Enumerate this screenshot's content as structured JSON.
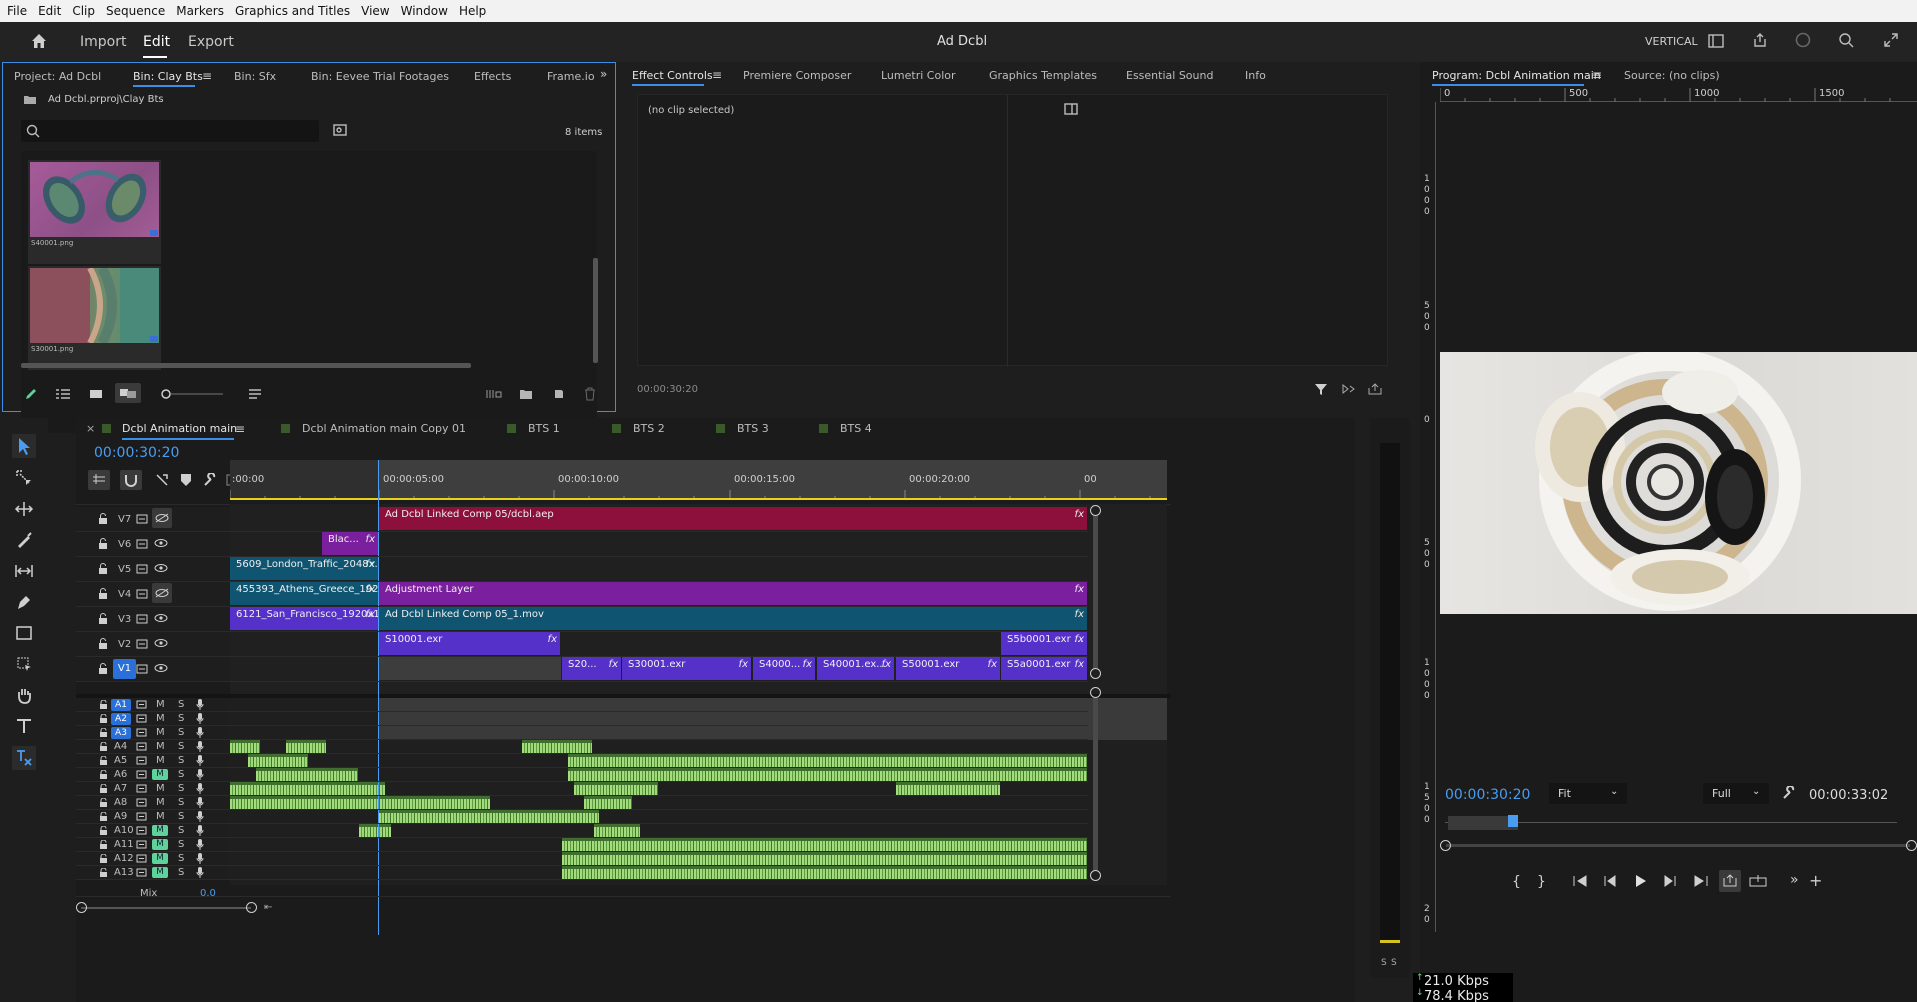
{
  "menu": [
    "File",
    "Edit",
    "Clip",
    "Sequence",
    "Markers",
    "Graphics and Titles",
    "View",
    "Window",
    "Help"
  ],
  "header": {
    "workspaces": [
      "Import",
      "Edit",
      "Export"
    ],
    "active_workspace": "Edit",
    "project_title": "Ad Dcbl",
    "layout_mode": "VERTICAL"
  },
  "project_panel": {
    "tabs": [
      "Project: Ad Dcbl",
      "Bin: Clay Bts",
      "Bin: Sfx",
      "Bin: Eevee Trial Footages",
      "Effects",
      "Frame.io"
    ],
    "active_tab": "Bin: Clay Bts",
    "path": "Ad Dcbl.prproj\\Clay Bts",
    "search_placeholder": "",
    "item_count": "8 items",
    "thumbnails": [
      {
        "name": "S40001.png"
      },
      {
        "name": "S30001.png"
      }
    ]
  },
  "effect_controls": {
    "tabs": [
      "Effect Controls",
      "Premiere Composer",
      "Lumetri Color",
      "Graphics Templates",
      "Essential Sound",
      "Info"
    ],
    "active_tab": "Effect Controls",
    "message": "(no clip selected)",
    "timecode": "00:00:30:20"
  },
  "program_monitor": {
    "tabs": [
      "Program: Dcbl Animation main",
      "Source: (no clips)"
    ],
    "active_tab": "Program: Dcbl Animation main",
    "ruler_h": [
      "0",
      "500",
      "1000",
      "1500"
    ],
    "ruler_v": [
      "1\n0\n0\n0",
      "5\n0\n0",
      "0",
      "5\n0\n0",
      "1\n0\n0\n0",
      "1\n5\n0\n0",
      "2\n0"
    ],
    "timecode": "00:00:30:20",
    "fit_label": "Fit",
    "quality_label": "Full",
    "duration": "00:00:33:02"
  },
  "timeline": {
    "tabs": [
      "Dcbl Animation main",
      "Dcbl Animation main  Copy 01",
      "BTS 1",
      "BTS 2",
      "BTS 3",
      "BTS 4"
    ],
    "active_tab": "Dcbl Animation main",
    "timecode": "00:00:30:20",
    "ruler": [
      ":00:00",
      "00:00:05:00",
      "00:00:10:00",
      "00:00:15:00",
      "00:00:20:00",
      "00"
    ],
    "video_tracks": [
      "V7",
      "V6",
      "V5",
      "V4",
      "V3",
      "V2",
      "V1"
    ],
    "audio_tracks": [
      "A1",
      "A2",
      "A3",
      "A4",
      "A5",
      "A6",
      "A7",
      "A8",
      "A9",
      "A10",
      "A11",
      "A12",
      "A13"
    ],
    "mix_label": "Mix",
    "mix_value": "0.0",
    "mute_label": "M",
    "solo_label": "S",
    "video_clips": [
      {
        "track": "V7",
        "label": "Ad Dcbl Linked Comp 05/dcbl.aep",
        "fx": "fx"
      },
      {
        "track": "V6",
        "label": "Blac...",
        "fx": "fx"
      },
      {
        "track": "V5",
        "label": "5609_London_Traffic_2048x...",
        "fx": "fx"
      },
      {
        "track": "V4",
        "label": "455393_Athens_Greece_192...",
        "fx": "fx"
      },
      {
        "track": "V4",
        "label": "Adjustment Layer",
        "fx": "fx"
      },
      {
        "track": "V3",
        "label": "6121_San_Francisco_1920x1...",
        "fx": "fx"
      },
      {
        "track": "V3",
        "label": "Ad Dcbl Linked Comp 05_1.mov",
        "fx": "fx"
      },
      {
        "track": "V2",
        "label": "S10001.exr",
        "fx": "fx"
      },
      {
        "track": "V2",
        "label": "S5b0001.exr ...",
        "fx": "fx"
      },
      {
        "track": "V1",
        "label": "S20...",
        "fx": "fx"
      },
      {
        "track": "V1",
        "label": "S30001.exr",
        "fx": "fx"
      },
      {
        "track": "V1",
        "label": "S4000...",
        "fx": "fx"
      },
      {
        "track": "V1",
        "label": "S40001.ex...",
        "fx": "fx"
      },
      {
        "track": "V1",
        "label": "S50001.exr",
        "fx": "fx"
      },
      {
        "track": "V1",
        "label": "S5a0001.exr",
        "fx": "fx"
      }
    ]
  },
  "audio_meter": {
    "labels": [
      "S",
      "S"
    ]
  },
  "network": {
    "up": "21.0 Kbps",
    "down": "78.4 Kbps"
  },
  "colors": {
    "accent": "#3a8ee6",
    "clip_crimson": "#8c0f3c",
    "clip_purple": "#7a1f9e",
    "clip_teal": "#0f5470",
    "clip_violet": "#5530c9",
    "audio_green": "#8ccf67",
    "mute_green": "#5fd19a"
  }
}
